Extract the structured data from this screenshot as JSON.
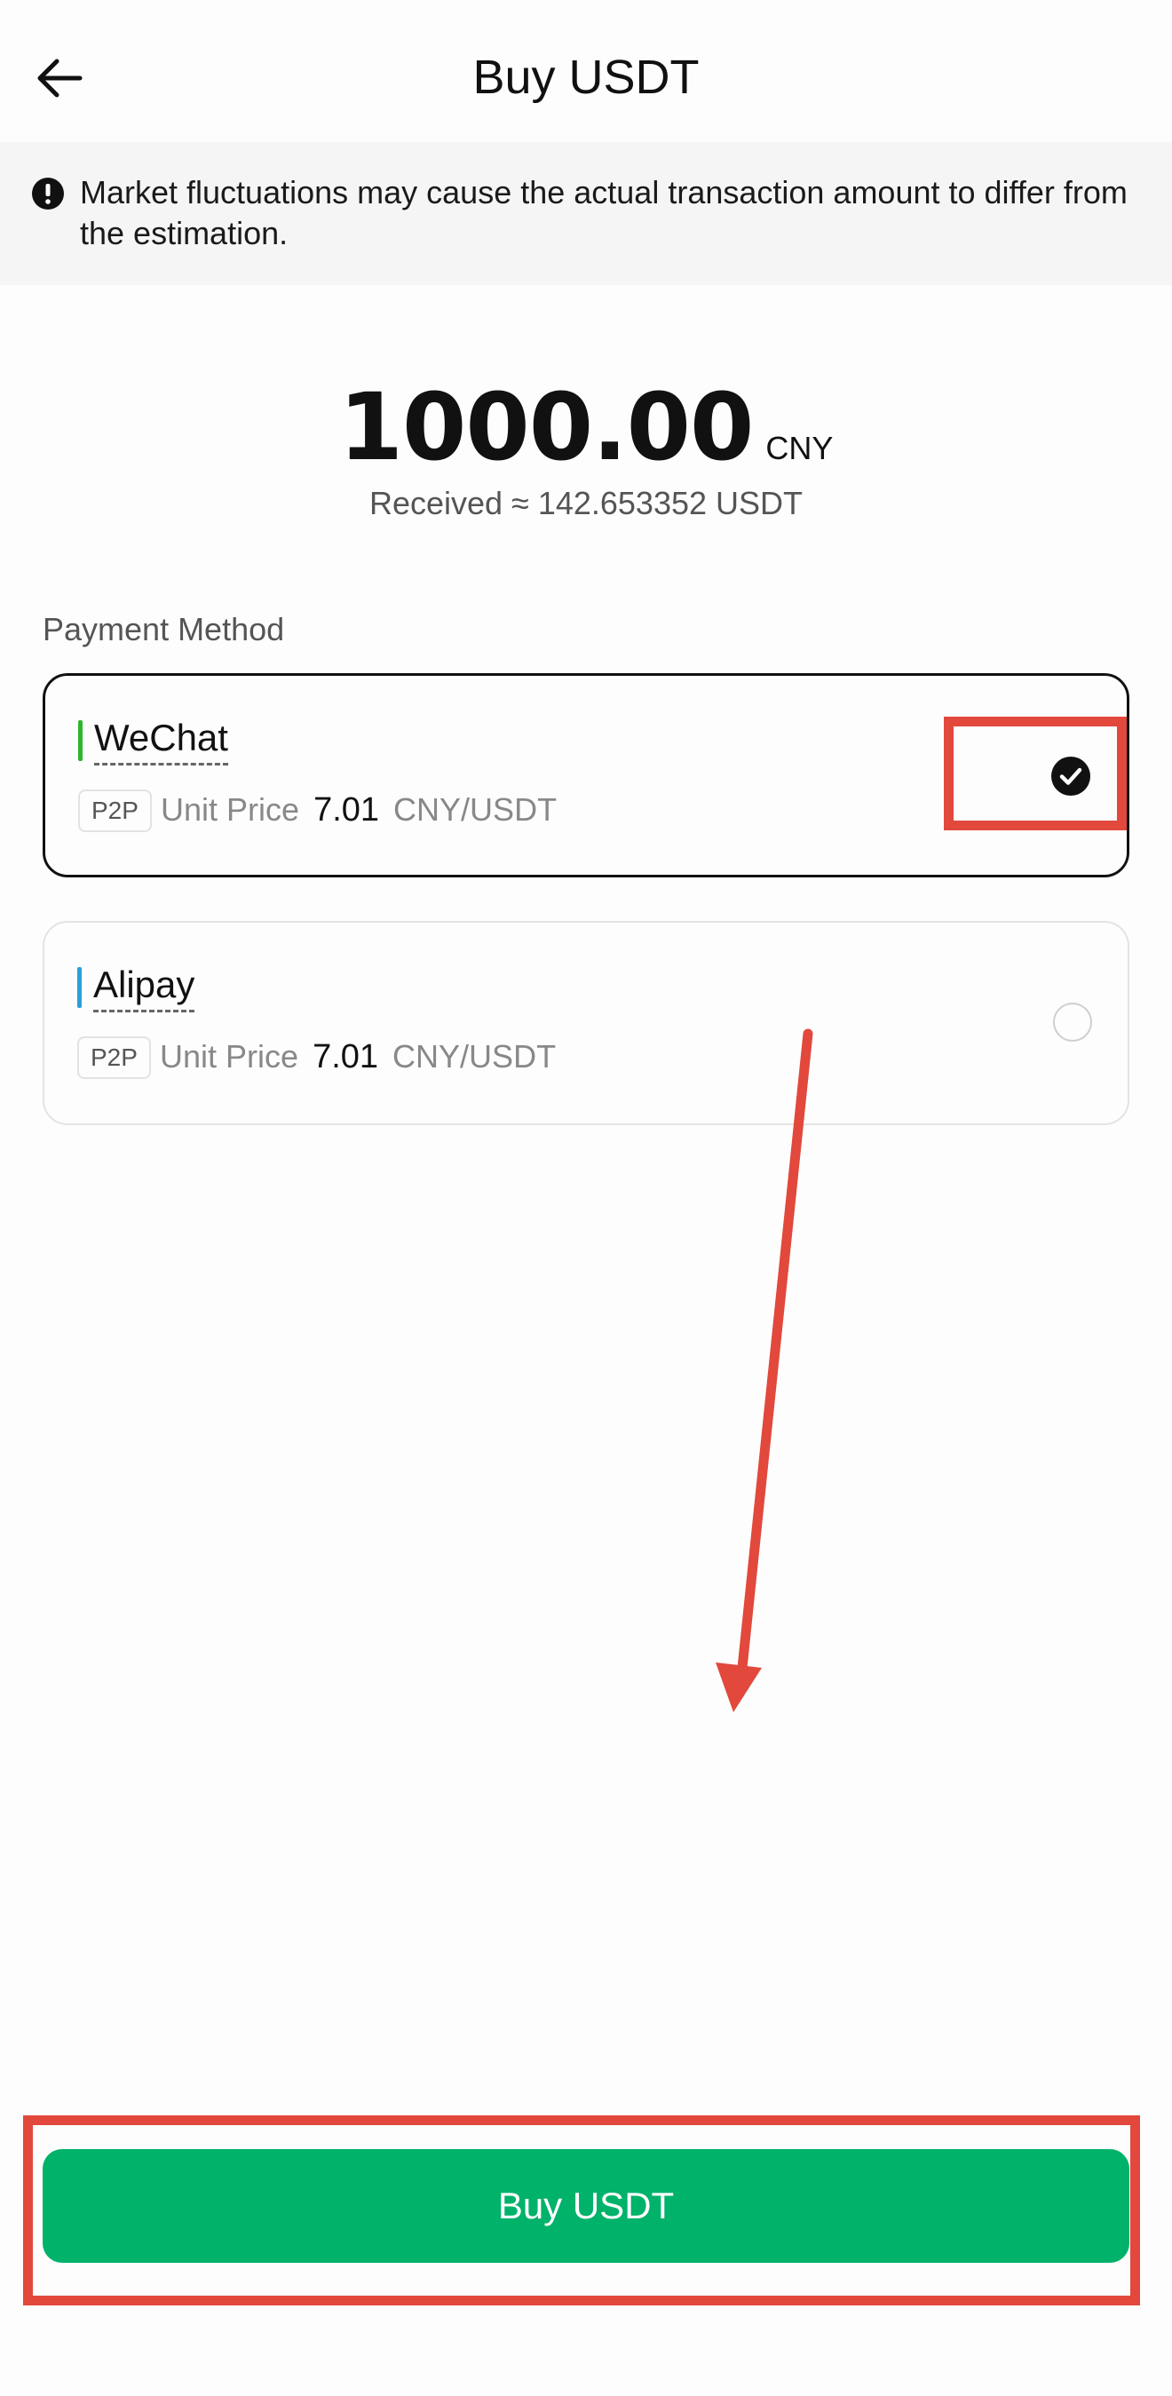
{
  "header": {
    "title": "Buy USDT",
    "back_icon": "arrow-left-icon"
  },
  "notice": {
    "icon": "exclamation-circle-icon",
    "text": "Market fluctuations may cause the actual transaction amount to differ from the estimation."
  },
  "amount": {
    "value": "1000.00",
    "currency": "CNY",
    "received": "Received ≈ 142.653352 USDT"
  },
  "payment": {
    "section_label": "Payment Method",
    "methods": [
      {
        "name": "WeChat",
        "tag": "P2P",
        "price_label": "Unit Price",
        "price_value": "7.01",
        "price_unit": "CNY/USDT",
        "selected": true,
        "accent_color": "#2db52d"
      },
      {
        "name": "Alipay",
        "tag": "P2P",
        "price_label": "Unit Price",
        "price_value": "7.01",
        "price_unit": "CNY/USDT",
        "selected": false,
        "accent_color": "#2a9fd8"
      }
    ]
  },
  "footer": {
    "buy_label": "Buy USDT"
  },
  "colors": {
    "primary": "#00b26a",
    "annotation": "#e2483c"
  }
}
